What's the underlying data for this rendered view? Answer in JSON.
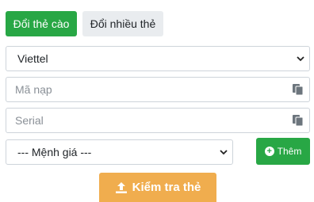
{
  "tabs": [
    {
      "label": "Đổi thẻ cào"
    },
    {
      "label": "Đổi nhiều thẻ"
    }
  ],
  "form": {
    "carrier": {
      "selected": "Viettel"
    },
    "pin": {
      "placeholder": "Mã nạp",
      "value": ""
    },
    "serial": {
      "placeholder": "Serial",
      "value": ""
    },
    "denomination": {
      "selected": "--- Mệnh giá ---"
    },
    "add_label": "Thêm",
    "check_label": "Kiểm tra thẻ"
  },
  "colors": {
    "primary_green": "#28a745",
    "accent_orange": "#f0ad4e",
    "tab_inactive": "#e9ecef"
  },
  "icons": [
    "chevron-down-icon",
    "copy-icon",
    "plus-circle-icon",
    "upload-icon"
  ]
}
